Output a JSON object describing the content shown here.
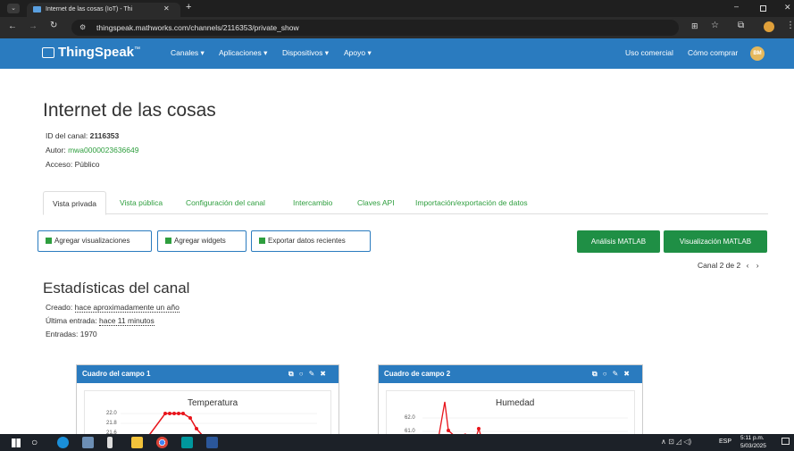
{
  "browser": {
    "tab_title": "Internet de las cosas (IoT) - Thi",
    "new_tab": "+",
    "url": "thingspeak.mathworks.com/channels/2116353/private_show"
  },
  "nav": {
    "logo": "ThingSpeak",
    "logo_tm": "™",
    "menu": [
      "Canales",
      "Aplicaciones",
      "Dispositivos",
      "Apoyo"
    ],
    "commercial": "Uso comercial",
    "buy": "Cómo comprar",
    "avatar": "BM"
  },
  "channel": {
    "title": "Internet de las cosas",
    "id_label": "ID del canal:",
    "id_value": "2116353",
    "author_label": "Autor:",
    "author_value": "mwa0000023636649",
    "access_label": "Acceso:",
    "access_value": "Público"
  },
  "tabs": [
    "Vista privada",
    "Vista pública",
    "Configuración del canal",
    "Intercambio",
    "Claves API",
    "Importación/exportación de datos"
  ],
  "buttons": {
    "add_vis": "Agregar visualizaciones",
    "add_widgets": "Agregar widgets",
    "export": "Exportar datos recientes",
    "matlab_analysis": "Análisis MATLAB",
    "matlab_vis": "Visualización MATLAB"
  },
  "pager": "Canal 2 de 2",
  "stats": {
    "title": "Estadísticas del canal",
    "created_label": "Creado:",
    "created_value": "hace aproximadamente un año",
    "last_label": "Última entrada:",
    "last_value": "hace 11 minutos",
    "entries": "Entradas: 1970"
  },
  "cards": [
    {
      "head": "Cuadro del campo 1",
      "chart_title": "Temperatura",
      "ticks": [
        "22.0",
        "21.8",
        "21.6"
      ]
    },
    {
      "head": "Cuadro de campo 2",
      "chart_title": "Humedad",
      "ticks": [
        "62.0",
        "61.0"
      ]
    }
  ],
  "taskbar": {
    "lang": "ESP",
    "time": "5:11 p.m.",
    "date": "5/03/2025"
  },
  "colors": {
    "nav_blue": "#2a7bbf",
    "green": "#2e9e3e",
    "button_green": "#1f8f45",
    "chart_red": "#e8141b"
  }
}
